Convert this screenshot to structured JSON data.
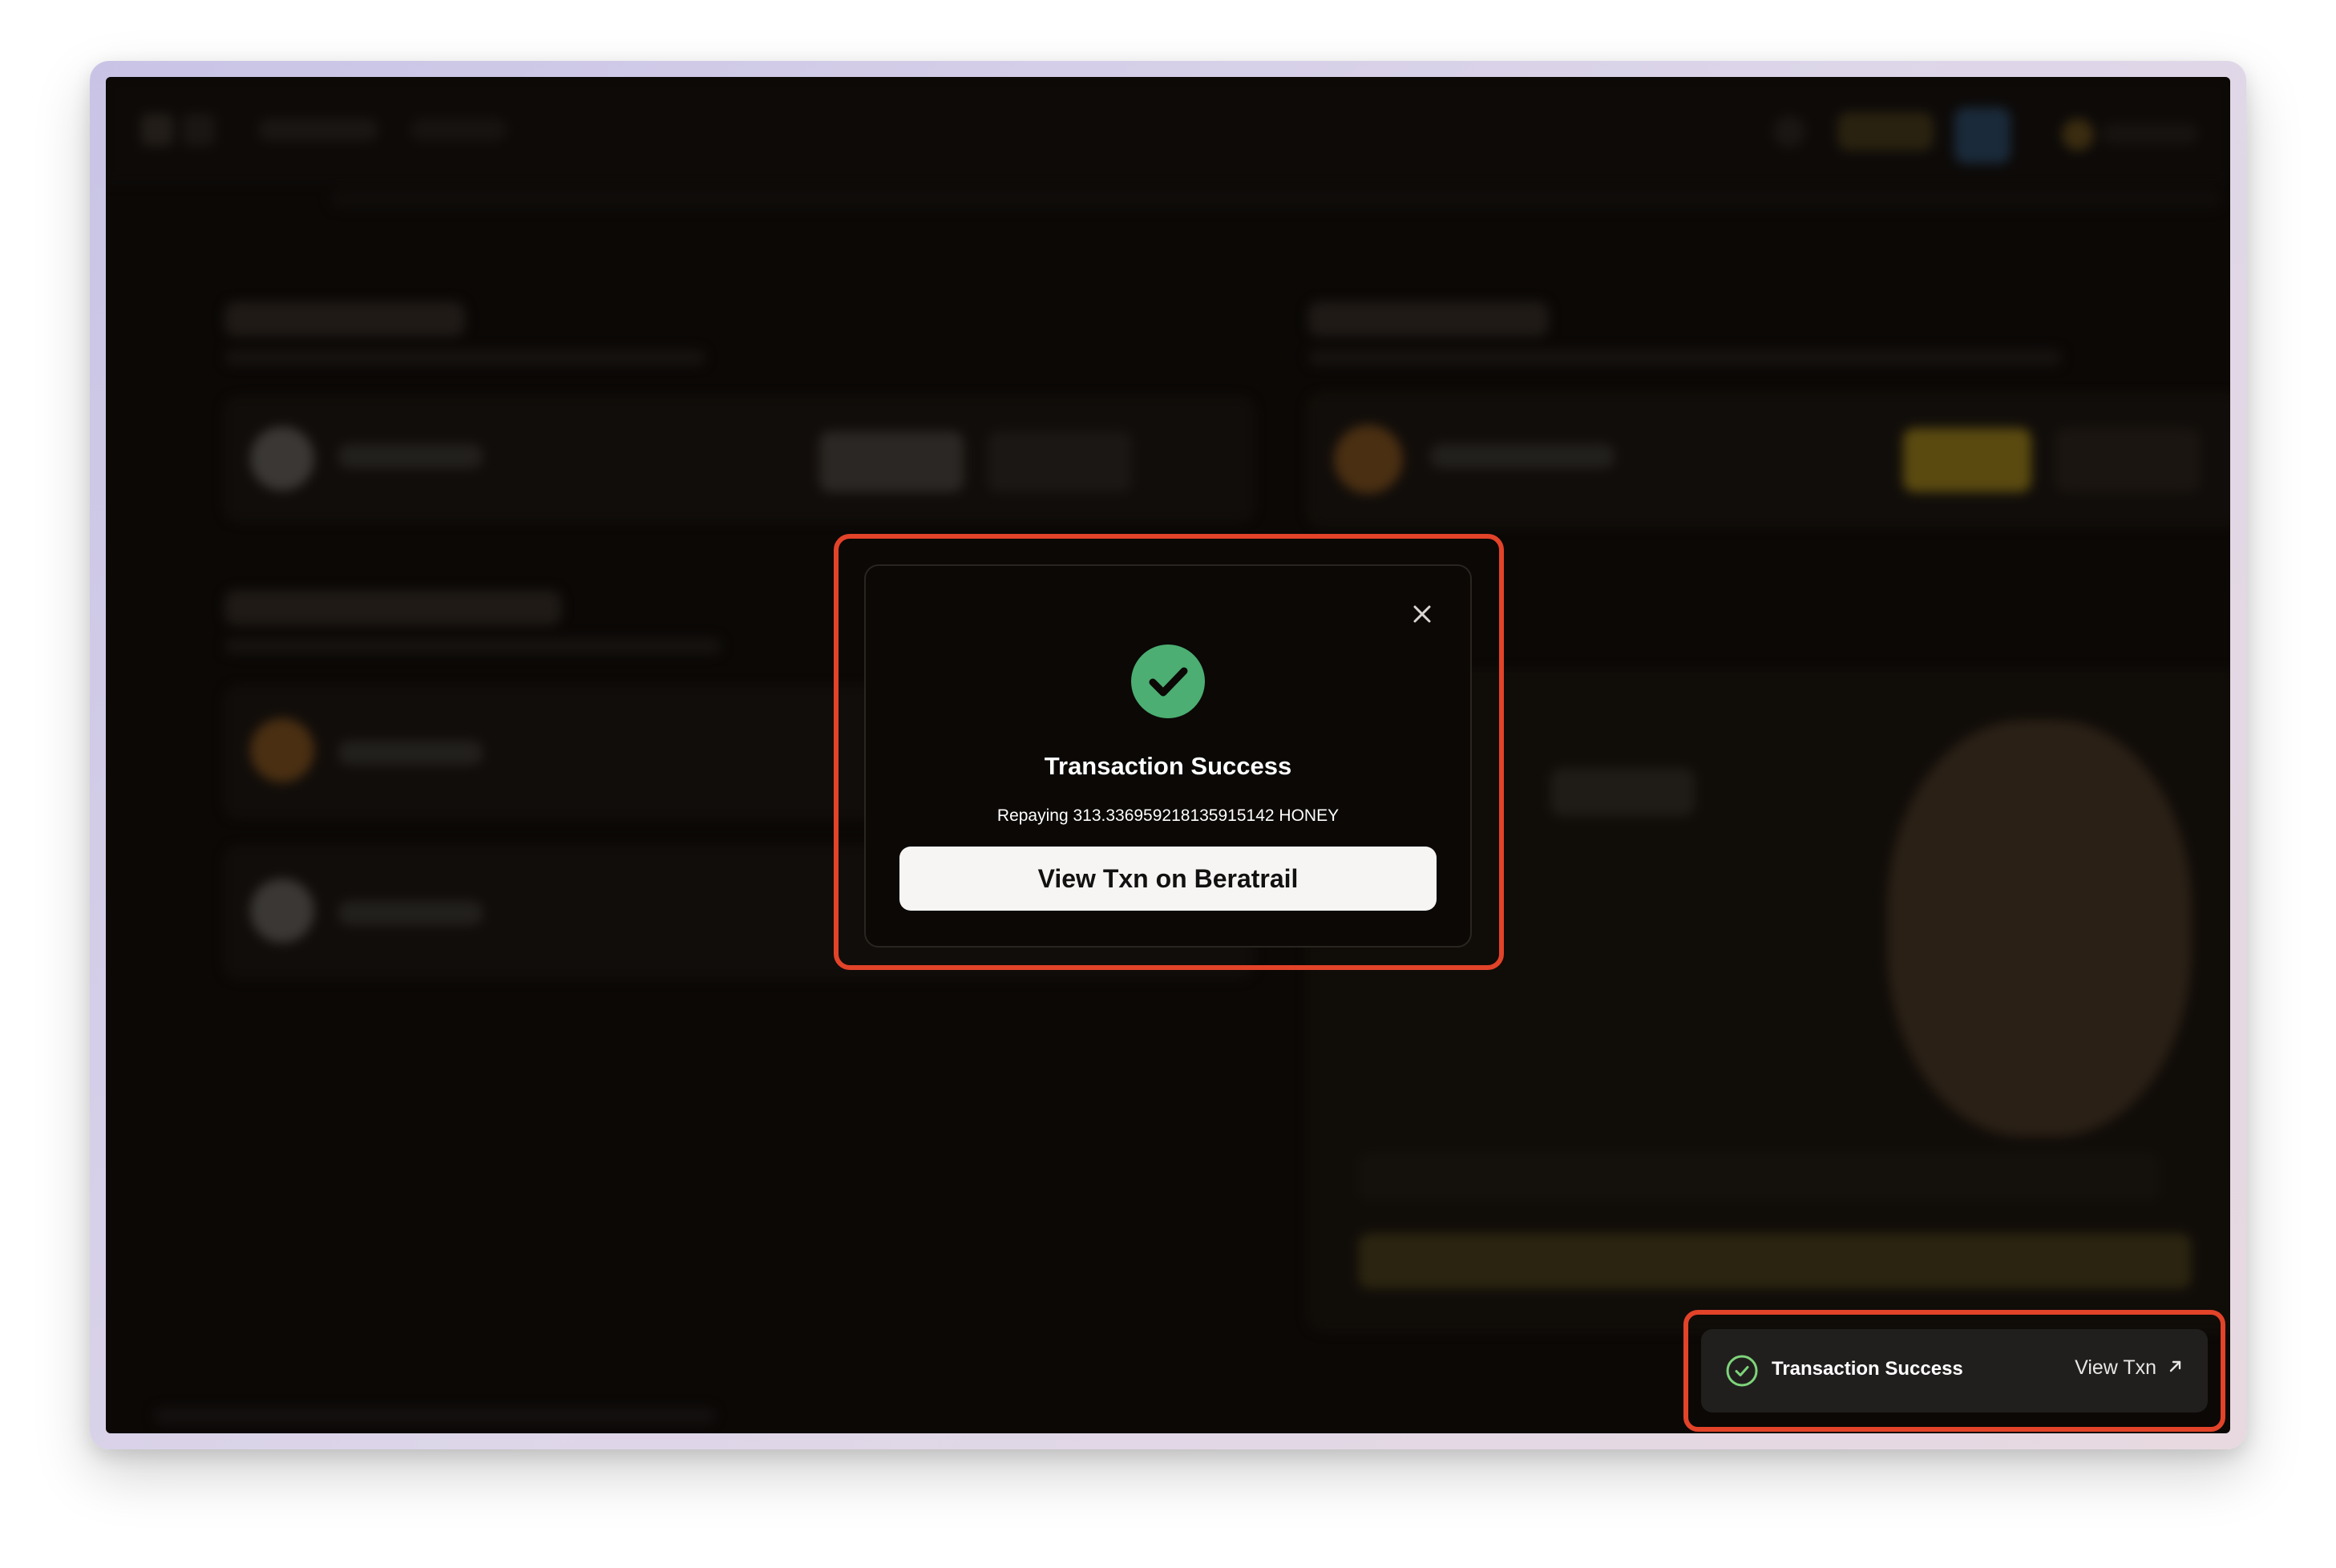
{
  "modal": {
    "title": "Transaction Success",
    "message": "Repaying 313.336959218135915142 HONEY",
    "button_label": "View Txn on Beratrail",
    "icon": "check-circle-icon",
    "icon_color": "#4cae72",
    "close_icon": "close-icon"
  },
  "toast": {
    "title": "Transaction Success",
    "link_label": "View Txn",
    "icon": "check-circle-outline-icon",
    "link_icon": "arrow-up-right-icon",
    "icon_color": "#7ed47a"
  },
  "colors": {
    "highlight": "#e24329",
    "app_background": "#0b0806"
  }
}
